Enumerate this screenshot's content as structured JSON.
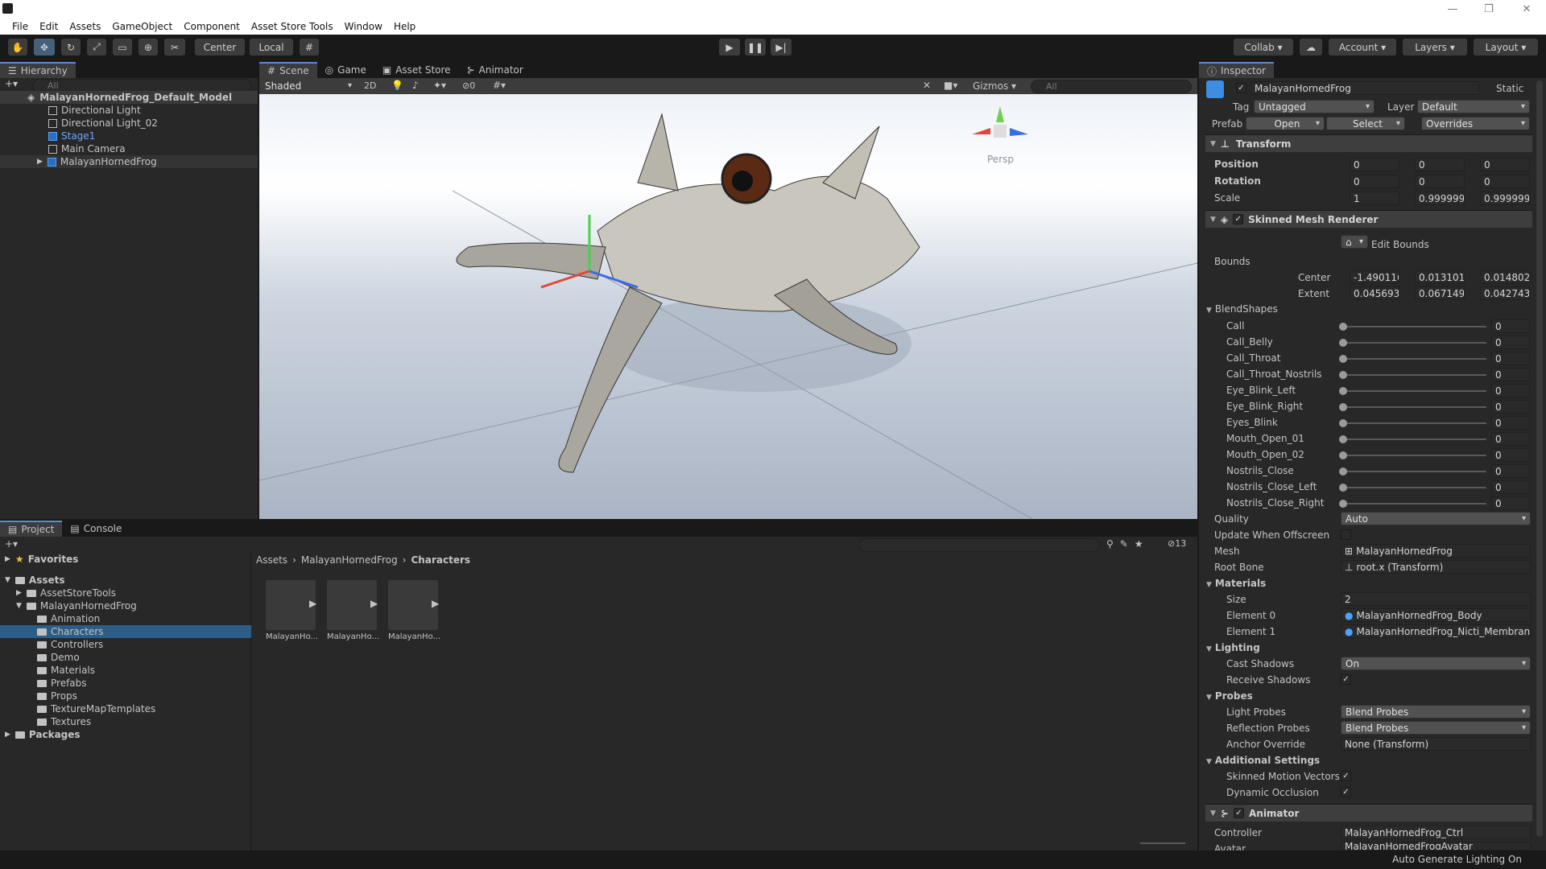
{
  "menu": {
    "items": [
      "File",
      "Edit",
      "Assets",
      "GameObject",
      "Component",
      "Asset Store Tools",
      "Window",
      "Help"
    ]
  },
  "toolbar": {
    "center": "Center",
    "local": "Local",
    "collab": "Collab",
    "account": "Account",
    "layers": "Layers",
    "layout": "Layout"
  },
  "hierarchy": {
    "tab": "Hierarchy",
    "search_placeholder": "All",
    "items": [
      "MalayanHornedFrog_Default_Model",
      "Directional Light",
      "Directional Light_02",
      "Stage1",
      "Main Camera",
      "MalayanHornedFrog"
    ]
  },
  "scene": {
    "tabs": [
      "Scene",
      "Game",
      "Asset Store",
      "Animator"
    ],
    "shading": "Shaded",
    "mode2d": "2D",
    "fx_count": "0",
    "gizmos": "Gizmos",
    "search_placeholder": "All",
    "persp": "Persp"
  },
  "project": {
    "tabs": [
      "Project",
      "Console"
    ],
    "count": "13",
    "breadcrumb": [
      "Assets",
      "MalayanHornedFrog",
      "Characters"
    ],
    "favorites": "Favorites",
    "tree": [
      "Assets",
      "AssetStoreTools",
      "MalayanHornedFrog",
      "Animation",
      "Characters",
      "Controllers",
      "Demo",
      "Materials",
      "Prefabs",
      "Props",
      "TextureMapTemplates",
      "Textures",
      "Packages"
    ],
    "assets": [
      "MalayanHo...",
      "MalayanHo...",
      "MalayanHo..."
    ]
  },
  "inspector": {
    "tab": "Inspector",
    "name": "MalayanHornedFrog",
    "static": "Static",
    "tag_label": "Tag",
    "tag": "Untagged",
    "layer_label": "Layer",
    "layer": "Default",
    "prefab_label": "Prefab",
    "open": "Open",
    "select": "Select",
    "overrides": "Overrides",
    "transform": {
      "title": "Transform",
      "position_label": "Position",
      "rotation_label": "Rotation",
      "scale_label": "Scale",
      "position": [
        "0",
        "0",
        "0"
      ],
      "rotation": [
        "0",
        "0",
        "0"
      ],
      "scale": [
        "1",
        "0.9999999",
        "0.9999999"
      ]
    },
    "smr": {
      "title": "Skinned Mesh Renderer",
      "edit_bounds": "Edit Bounds",
      "bounds": "Bounds",
      "center_label": "Center",
      "extent_label": "Extent",
      "center": [
        "-1.490116",
        "0.013101€",
        "0.014802"
      ],
      "extent": [
        "0.045693",
        "0.067149",
        "0.042743"
      ],
      "blendshapes_label": "BlendShapes",
      "blendshapes": [
        {
          "name": "Call",
          "value": "0"
        },
        {
          "name": "Call_Belly",
          "value": "0"
        },
        {
          "name": "Call_Throat",
          "value": "0"
        },
        {
          "name": "Call_Throat_Nostrils",
          "value": "0"
        },
        {
          "name": "Eye_Blink_Left",
          "value": "0"
        },
        {
          "name": "Eye_Blink_Right",
          "value": "0"
        },
        {
          "name": "Eyes_Blink",
          "value": "0"
        },
        {
          "name": "Mouth_Open_01",
          "value": "0"
        },
        {
          "name": "Mouth_Open_02",
          "value": "0"
        },
        {
          "name": "Nostrils_Close",
          "value": "0"
        },
        {
          "name": "Nostrils_Close_Left",
          "value": "0"
        },
        {
          "name": "Nostrils_Close_Right",
          "value": "0"
        }
      ],
      "quality_label": "Quality",
      "quality": "Auto",
      "update_offscreen": "Update When Offscreen",
      "mesh_label": "Mesh",
      "mesh": "MalayanHornedFrog",
      "rootbone_label": "Root Bone",
      "rootbone": "root.x (Transform)",
      "materials_label": "Materials",
      "size_label": "Size",
      "size": "2",
      "el0_label": "Element 0",
      "el0": "MalayanHornedFrog_Body",
      "el1_label": "Element 1",
      "el1": "MalayanHornedFrog_Nicti_Membran",
      "lighting_label": "Lighting",
      "cast_label": "Cast Shadows",
      "cast": "On",
      "receive_label": "Receive Shadows",
      "probes_label": "Probes",
      "light_probes_label": "Light Probes",
      "light_probes": "Blend Probes",
      "refl_label": "Reflection Probes",
      "refl": "Blend Probes",
      "anchor_label": "Anchor Override",
      "anchor": "None (Transform)",
      "additional_label": "Additional Settings",
      "motion_label": "Skinned Motion Vectors",
      "occlusion_label": "Dynamic Occlusion"
    },
    "animator": {
      "title": "Animator",
      "controller_label": "Controller",
      "controller": "MalayanHornedFrog_Ctrl",
      "avatar_label": "Avatar",
      "avatar": "MalayanHornedFrogAvatar"
    }
  },
  "status": {
    "text": "Auto Generate Lighting On"
  }
}
